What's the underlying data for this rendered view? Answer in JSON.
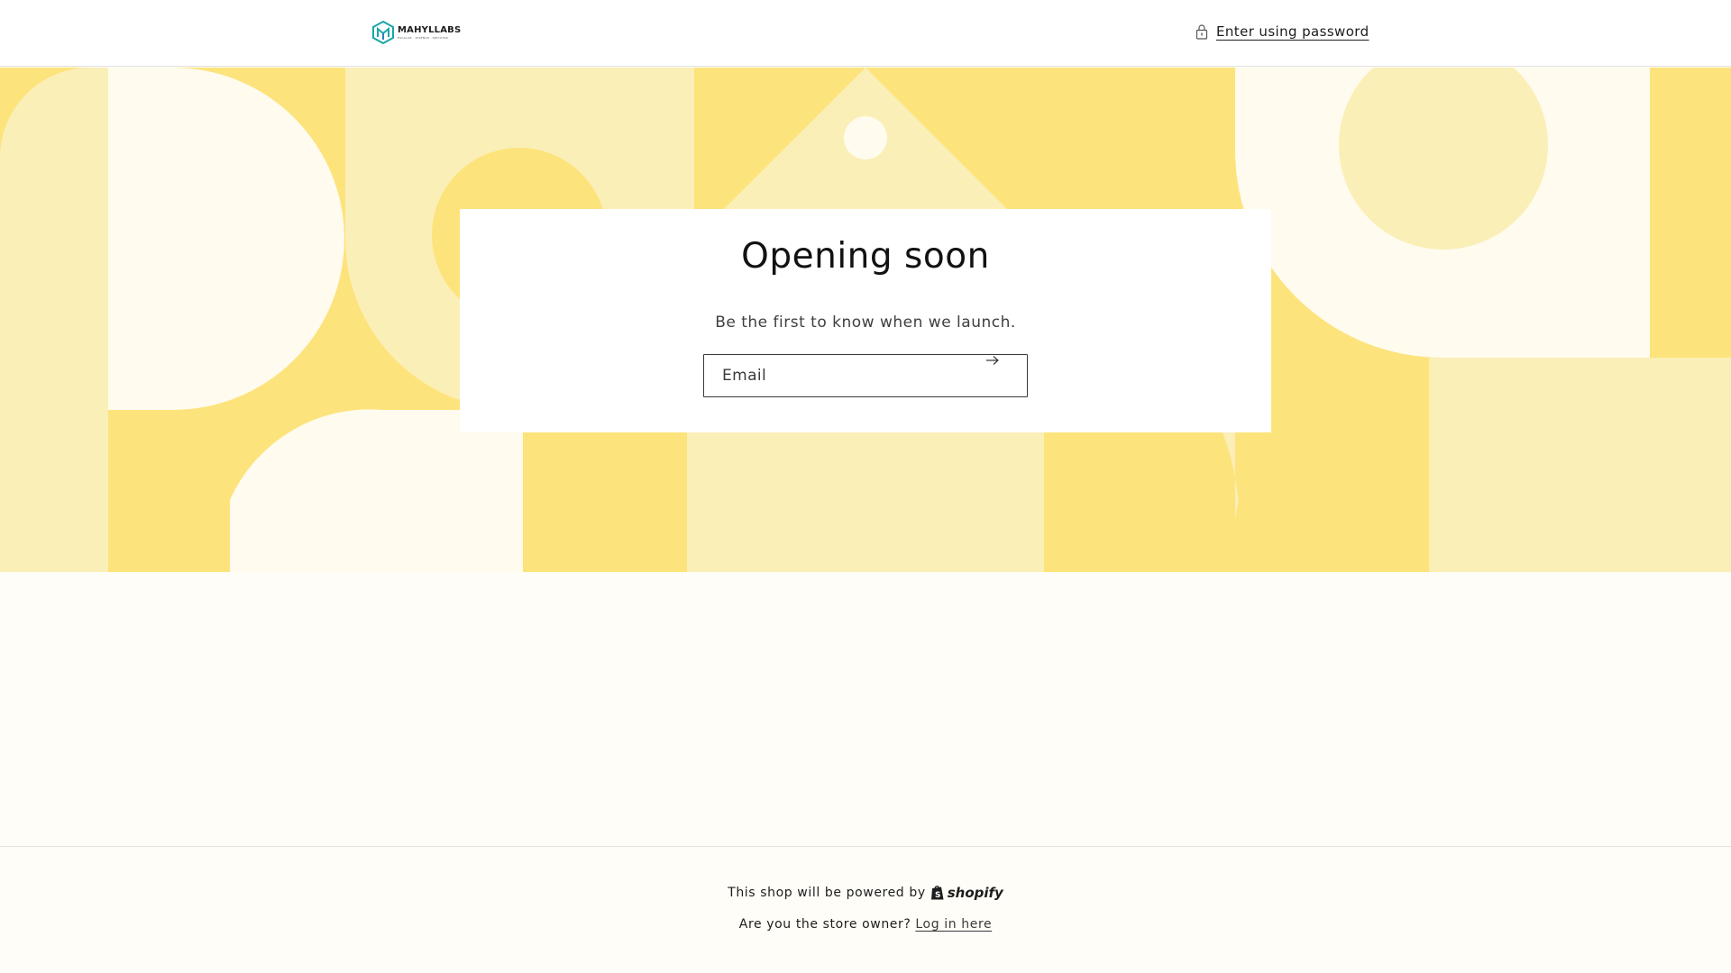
{
  "header": {
    "logo": {
      "name": "MAHYLLABS",
      "tagline": "ESCALAR · DISEÑAR · EJECUTAR"
    },
    "password_link": {
      "label": "Enter using password",
      "icon": "lock-icon"
    }
  },
  "hero": {
    "title": "Opening soon",
    "subtitle": "Be the first to know when we launch.",
    "email": {
      "placeholder": "Email",
      "value": ""
    },
    "submit_icon": "arrow-right-icon"
  },
  "footer": {
    "powered_text": "This shop will be powered by",
    "shopify_label": "shopify",
    "owner_text": "Are you the store owner?",
    "login_label": "Log in here"
  },
  "colors": {
    "banner_dark": "#fde37b",
    "banner_mid": "#fbefb8",
    "banner_light": "#fffbee",
    "logo_accent": "#1aa6a6"
  }
}
